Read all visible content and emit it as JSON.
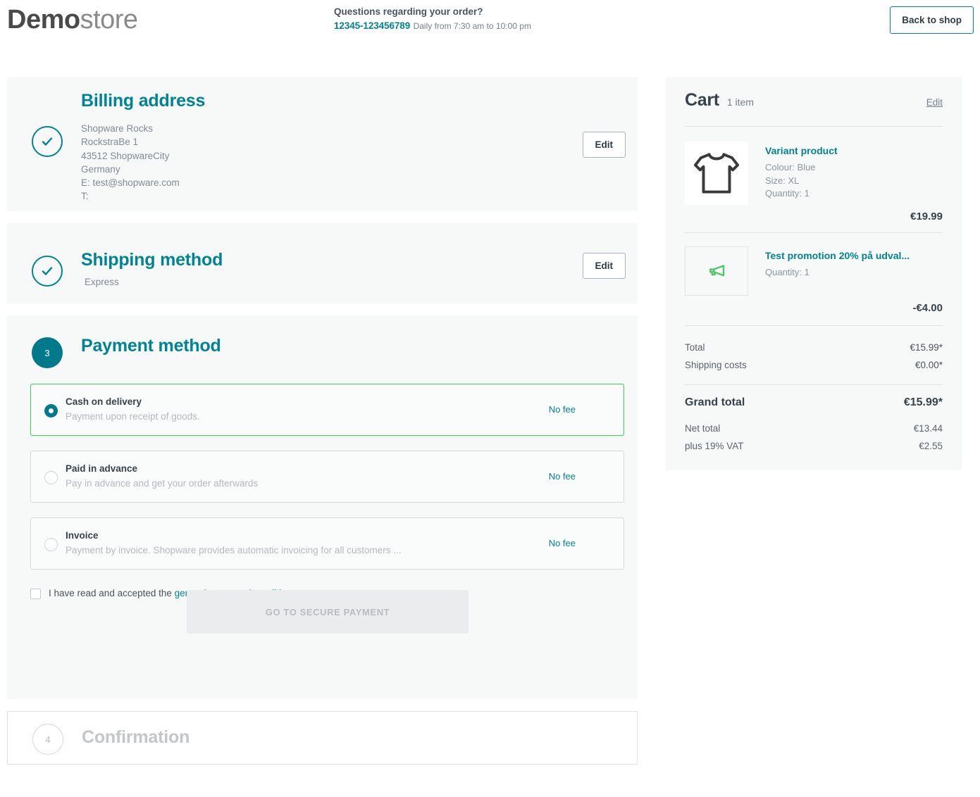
{
  "header": {
    "logo_bold": "Demo",
    "logo_light": "store",
    "contact_title": "Questions regarding your order?",
    "phone": "12345-123456789",
    "hours": "Daily from 7:30 am to 10:00 pm",
    "back_to_shop": "Back to shop"
  },
  "steps": {
    "billing": {
      "title": "Billing address",
      "indicator": "check-icon",
      "edit_label": "Edit",
      "address_lines": [
        "Shopware Rocks",
        "RockstraBe 1",
        "43512 ShopwareCity",
        "Germany",
        "E: test@shopware.com",
        "T:"
      ]
    },
    "shipping": {
      "title": "Shipping method",
      "indicator": "check-icon",
      "edit_label": "Edit",
      "value": "Express"
    },
    "payment": {
      "title": "Payment method",
      "step_number": "3",
      "options": [
        {
          "name": "Cash on delivery",
          "description": "Payment upon receipt of goods.",
          "fee": "No fee",
          "selected": true
        },
        {
          "name": "Paid in advance",
          "description": "Pay in advance and get your order afterwards",
          "fee": "No fee",
          "selected": false
        },
        {
          "name": "Invoice",
          "description": "Payment by invoice. Shopware provides automatic invoicing for all customers ...",
          "fee": "No fee",
          "selected": false
        }
      ],
      "terms_prefix": "I have read and accepted the ",
      "terms_link": "general terms and conditions",
      "terms_suffix": ".",
      "terms_checked": false,
      "submit_label": "GO TO SECURE PAYMENT",
      "submit_disabled": true
    },
    "confirmation": {
      "title": "Confirmation",
      "step_number": "4"
    }
  },
  "cart": {
    "title": "Cart",
    "count": "1 item",
    "edit_label": "Edit",
    "items": [
      {
        "name": "Variant product",
        "icon": "shirt-icon",
        "meta": [
          "Colour: Blue",
          "Size: XL",
          "Quantity: 1"
        ],
        "price": "€19.99"
      },
      {
        "name": "Test promotion 20% på udval...",
        "icon": "megaphone-icon",
        "meta": [
          "Quantity: 1"
        ],
        "price": "-€4.00"
      }
    ],
    "totals": [
      {
        "label": "Total",
        "value": "€15.99*"
      },
      {
        "label": "Shipping costs",
        "value": "€0.00*"
      }
    ],
    "grand_total": {
      "label": "Grand total",
      "value": "€15.99*"
    },
    "sub_totals": [
      {
        "label": "Net total",
        "value": "€13.44"
      },
      {
        "label": "plus 19% VAT",
        "value": "€2.55"
      }
    ]
  },
  "colors": {
    "brand_teal": "#008490",
    "indicator_teal": "#00798a",
    "selected_green": "#3ecf5b",
    "promo_green": "#4CC764",
    "text_dark": "#37424b",
    "text_muted": "#8d979f",
    "panel_bg": "#f7f8f8"
  }
}
